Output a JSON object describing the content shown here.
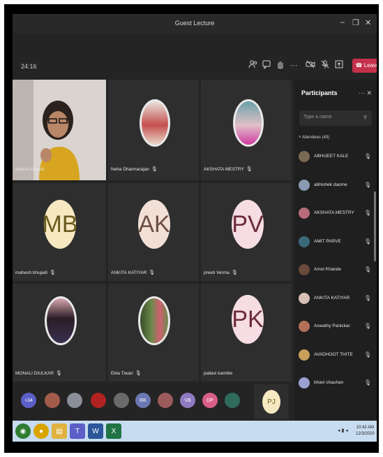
{
  "window": {
    "title": "Guest Lecture",
    "minimize": "–",
    "restore": "❐",
    "close": "✕"
  },
  "toolbar": {
    "timer": "24:16",
    "leave_label": "Leave",
    "icons": [
      "participants-icon",
      "chat-icon",
      "raise-hand-icon",
      "more-icon",
      "camera-off-icon",
      "mic-off-icon",
      "share-icon"
    ]
  },
  "tiles": [
    {
      "name": "deepa (Guest)",
      "type": "video"
    },
    {
      "name": "Neha Dharmarajan",
      "type": "photo"
    },
    {
      "name": "AKSHATA MESTRY",
      "type": "photo"
    },
    {
      "name": "mahesh bhujadi",
      "type": "initials",
      "initials": "MB",
      "bg": "#f6e9c1",
      "fg": "#6b5a1e"
    },
    {
      "name": "ANKITA KATIYAR",
      "type": "initials",
      "initials": "AK",
      "bg": "#f2e0d6",
      "fg": "#6c4e42"
    },
    {
      "name": "preeti Verma",
      "type": "initials",
      "initials": "PV",
      "bg": "#f6dde3",
      "fg": "#6b2c3c"
    },
    {
      "name": "MONALI DIULKAR",
      "type": "photo"
    },
    {
      "name": "Ekta Tiwari",
      "type": "photo"
    },
    {
      "name": "pallavi kamble",
      "type": "initials",
      "initials": "PK",
      "bg": "#f6dde3",
      "fg": "#6b2c3c"
    }
  ],
  "strip": {
    "overflow": "+34",
    "items": [
      {
        "label": "+34",
        "color": "#5b5fc7"
      },
      {
        "label": "",
        "color": "#a35b4a"
      },
      {
        "label": "",
        "color": "#8a8f9a"
      },
      {
        "label": "",
        "color": "#b22222"
      },
      {
        "label": "",
        "color": "#6a6a6a"
      },
      {
        "label": "RK",
        "color": "#6b78b4"
      },
      {
        "label": "",
        "color": "#9c5b5b"
      },
      {
        "label": "VB",
        "color": "#8e7bc2"
      },
      {
        "label": "DP",
        "color": "#d95f87"
      },
      {
        "label": "",
        "color": "#2f6b5b"
      }
    ],
    "last": {
      "label": "PJ",
      "bg": "#f6e9c1",
      "fg": "#6b5a1e"
    }
  },
  "participants": {
    "title": "Participants",
    "more": "···  ✕",
    "search_placeholder": "Type a name",
    "attendees_label": "˅ Attendees (49)",
    "list": [
      {
        "name": "ABHIJEET KALE",
        "color": "#7a6a55"
      },
      {
        "name": "abhishek daome",
        "color": "#8a9ab0"
      },
      {
        "name": "AKSHATA MESTRY",
        "color": "#b86b7a"
      },
      {
        "name": "AMIT PARVE",
        "color": "#3a6a7a"
      },
      {
        "name": "Amol Khande",
        "color": "#6a4a3a"
      },
      {
        "name": "ANKITA KATIYAR",
        "color": "#d8c0b8"
      },
      {
        "name": "Aswathy Panickar",
        "color": "#b5705a"
      },
      {
        "name": "AVADHOOT THITE",
        "color": "#c8a05a"
      },
      {
        "name": "bhavi chauhan",
        "color": "#9aa0d0"
      }
    ]
  },
  "taskbar": {
    "time": "10:42 AM",
    "date": "12/3/2020",
    "apps": [
      {
        "name": "start-button",
        "color": "#2f7d32",
        "glyph": "◉"
      },
      {
        "name": "chrome-icon",
        "color": "#d9a400",
        "glyph": "●"
      },
      {
        "name": "explorer-icon",
        "color": "#e0b340",
        "glyph": "▤"
      },
      {
        "name": "teams-icon",
        "color": "#5b5fc7",
        "glyph": "T"
      },
      {
        "name": "word-icon",
        "color": "#2b579a",
        "glyph": "W"
      },
      {
        "name": "excel-icon",
        "color": "#217346",
        "glyph": "X"
      }
    ]
  }
}
